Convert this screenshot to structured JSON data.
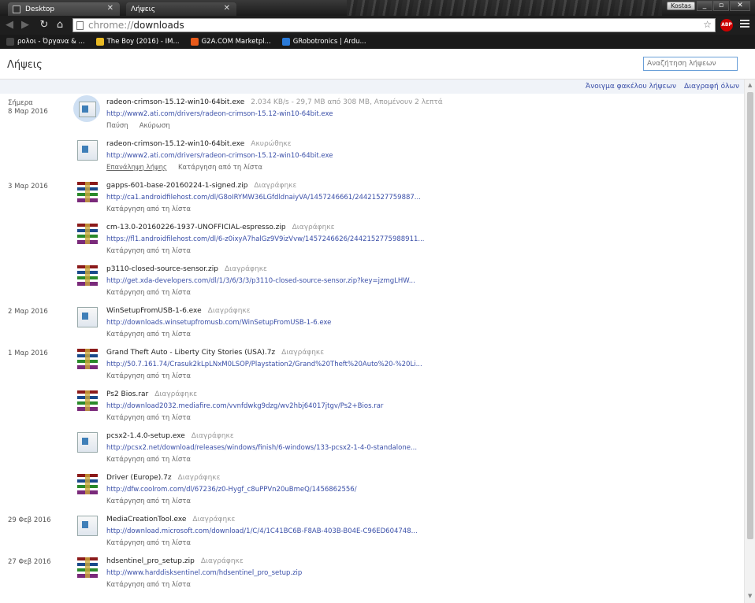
{
  "window": {
    "tabs": [
      {
        "label": "Desktop",
        "active": false
      },
      {
        "label": "Λήψεις",
        "active": true
      }
    ],
    "user": "Kostas",
    "controls": {
      "minimize": "_",
      "maximize": "▫",
      "close": "✕"
    }
  },
  "toolbar": {
    "url_scheme": "chrome://",
    "url_path": "downloads",
    "abp_label": "ABP"
  },
  "bookmarks": [
    {
      "label": "ρολοι - Όργανα & ...",
      "icon": "generic-icon",
      "color": "#444444"
    },
    {
      "label": "The Boy (2016) - IM...",
      "icon": "imdb-icon",
      "color": "#e8b923"
    },
    {
      "label": "G2A.COM Marketpl...",
      "icon": "g2a-icon",
      "color": "#e85a1a"
    },
    {
      "label": "GRobotronics | Ardu...",
      "icon": "grobotronics-icon",
      "color": "#2a7ad8"
    }
  ],
  "page": {
    "title": "Λήψεις",
    "search_placeholder": "Αναζήτηση λήψεων",
    "open_folder": "Άνοιγμα φακέλου λήψεων",
    "clear_all": "Διαγραφή όλων"
  },
  "downloads": [
    {
      "date1": "Σήμερα",
      "date2": "8 Μαρ 2016",
      "icon": "exe-progress",
      "name": "radeon-crimson-15.12-win10-64bit.exe",
      "status": "2.034 KB/s - 29,7 MB από 308 MB, Απομένουν 2 λεπτά",
      "url": "http://www2.ati.com/drivers/radeon-crimson-15.12-win10-64bit.exe",
      "actions": [
        "Παύση",
        "Ακύρωση"
      ]
    },
    {
      "date1": "",
      "date2": "",
      "icon": "exe",
      "name": "radeon-crimson-15.12-win10-64bit.exe",
      "status": "Ακυρώθηκε",
      "url": "http://www2.ati.com/drivers/radeon-crimson-15.12-win10-64bit.exe",
      "actions": [
        "Επανάληψη λήψης",
        "Κατάργηση από τη λίστα"
      ]
    },
    {
      "date1": "3 Μαρ 2016",
      "date2": "",
      "icon": "zip",
      "name": "gapps-601-base-20160224-1-signed.zip",
      "status": "Διαγράφηκε",
      "url": "http://ca1.androidfilehost.com/dl/G8oIRYMW36LGfdldnaiyVA/1457246661/24421527759887...",
      "actions": [
        "Κατάργηση από τη λίστα"
      ]
    },
    {
      "date1": "",
      "date2": "",
      "icon": "zip",
      "name": "cm-13.0-20160226-1937-UNOFFICIAL-espresso.zip",
      "status": "Διαγράφηκε",
      "url": "https://fl1.androidfilehost.com/dl/6-z0ixyA7halGz9V9izVvw/1457246626/2442152775988911...",
      "actions": [
        "Κατάργηση από τη λίστα"
      ]
    },
    {
      "date1": "",
      "date2": "",
      "icon": "zip",
      "name": "p3110-closed-source-sensor.zip",
      "status": "Διαγράφηκε",
      "url": "http://get.xda-developers.com/dl/1/3/6/3/3/p3110-closed-source-sensor.zip?key=jzmgLHW...",
      "actions": [
        "Κατάργηση από τη λίστα"
      ]
    },
    {
      "date1": "2 Μαρ 2016",
      "date2": "",
      "icon": "exe",
      "name": "WinSetupFromUSB-1-6.exe",
      "status": "Διαγράφηκε",
      "url": "http://downloads.winsetupfromusb.com/WinSetupFromUSB-1-6.exe",
      "actions": [
        "Κατάργηση από τη λίστα"
      ]
    },
    {
      "date1": "1 Μαρ 2016",
      "date2": "",
      "icon": "zip",
      "name": "Grand Theft Auto - Liberty City Stories (USA).7z",
      "status": "Διαγράφηκε",
      "url": "http://50.7.161.74/Crasuk2kLpLNxM0LSOP/Playstation2/Grand%20Theft%20Auto%20-%20Li...",
      "actions": [
        "Κατάργηση από τη λίστα"
      ]
    },
    {
      "date1": "",
      "date2": "",
      "icon": "zip",
      "name": "Ps2 Bios.rar",
      "status": "Διαγράφηκε",
      "url": "http://download2032.mediafire.com/vvnfdwkg9dzg/wv2hbj64017jtgv/Ps2+Bios.rar",
      "actions": [
        "Κατάργηση από τη λίστα"
      ]
    },
    {
      "date1": "",
      "date2": "",
      "icon": "exe",
      "name": "pcsx2-1.4.0-setup.exe",
      "status": "Διαγράφηκε",
      "url": "http://pcsx2.net/download/releases/windows/finish/6-windows/133-pcsx2-1-4-0-standalone...",
      "actions": [
        "Κατάργηση από τη λίστα"
      ]
    },
    {
      "date1": "",
      "date2": "",
      "icon": "zip",
      "name": "Driver (Europe).7z",
      "status": "Διαγράφηκε",
      "url": "http://dfw.coolrom.com/dl/67236/z0-Hygf_c8uPPVn20uBmeQ/1456862556/",
      "actions": [
        "Κατάργηση από τη λίστα"
      ]
    },
    {
      "date1": "29 Φεβ 2016",
      "date2": "",
      "icon": "exe",
      "name": "MediaCreationTool.exe",
      "status": "Διαγράφηκε",
      "url": "http://download.microsoft.com/download/1/C/4/1C41BC6B-F8AB-403B-B04E-C96ED604748...",
      "actions": [
        "Κατάργηση από τη λίστα"
      ]
    },
    {
      "date1": "27 Φεβ 2016",
      "date2": "",
      "icon": "zip",
      "name": "hdsentinel_pro_setup.zip",
      "status": "Διαγράφηκε",
      "url": "http://www.harddisksentinel.com/hdsentinel_pro_setup.zip",
      "actions": [
        "Κατάργηση από τη λίστα"
      ]
    }
  ]
}
